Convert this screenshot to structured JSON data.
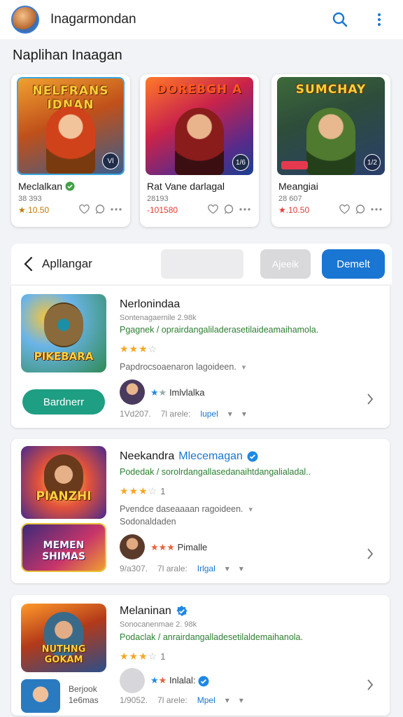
{
  "header": {
    "title": "Inagarmondan",
    "logo_icon": "game-avatar-icon",
    "search_icon": "search-icon",
    "menu_icon": "more-vertical-icon"
  },
  "section_title": "Naplihan Inaagan",
  "featured": [
    {
      "art_title": "NELFRANS IDNAN",
      "name": "Meclalkan",
      "verified": true,
      "sub": "38 393",
      "rating": "★.10.50",
      "corner": "Vl"
    },
    {
      "art_title": "DOREBGH A",
      "name": "Rat Vane darlagal",
      "verified": false,
      "sub": "28193",
      "rating": "-101580",
      "corner": "1/6"
    },
    {
      "art_title": "SUMCHAY",
      "name": "Meangiai",
      "verified": false,
      "sub": "28 607",
      "rating": "★.10.50",
      "corner": "1/2"
    }
  ],
  "toolbar": {
    "back_label": "Apllangar",
    "gray_button": "Ajeeik",
    "blue_button": "Demelt"
  },
  "list": [
    {
      "art_title": "PIKEBARA",
      "title": "Nerlonindaa",
      "title_accent": "",
      "meta": "Sontenagaemile 2.98k",
      "desc": "Pgagnek / oprairdangaliladerasetilaideamaihamola.",
      "stars_on": 3,
      "stars_off": 1,
      "stars_num": "",
      "note": "Papdrocsoaenaron lagoideen.",
      "note2": "",
      "user": "Imlvlalka",
      "foot_date": "1Vd207.",
      "foot_mid": "7l arele:",
      "foot_link": "lupel",
      "button": "Bardnerr"
    },
    {
      "art_title": "PIANZHI",
      "art_title2": "MEMEN SHIMAS",
      "title": "Neekandra",
      "title_accent": "Mlecemagan",
      "meta": "",
      "desc": "Podedak / sorolrdangallasedanaihtdangalialadal..",
      "stars_on": 3,
      "stars_off": 1,
      "stars_num": "1",
      "note": "Pvendce daseaaaan ragoideen.",
      "note2": "Sodonaldaden",
      "user": "Pimalle",
      "foot_date": "9/a307.",
      "foot_mid": "7l arale:",
      "foot_link": "Irlgal",
      "button": ""
    },
    {
      "art_title": "NUTHNG GOKAM",
      "title": "Melaninan",
      "title_accent": "",
      "meta": "Sonocanenmae 2. 98k",
      "desc": "Podaclak / anrairdangalladesetilaldemaihanola.",
      "stars_on": 3,
      "stars_off": 1,
      "stars_num": "1",
      "note": "",
      "note2": "",
      "user": "Inlalal:",
      "foot_date": "1/9052.",
      "foot_mid": "7l arele:",
      "foot_link": "Mpel",
      "mini_label": "Berjook 1e6mas",
      "button": ""
    }
  ]
}
